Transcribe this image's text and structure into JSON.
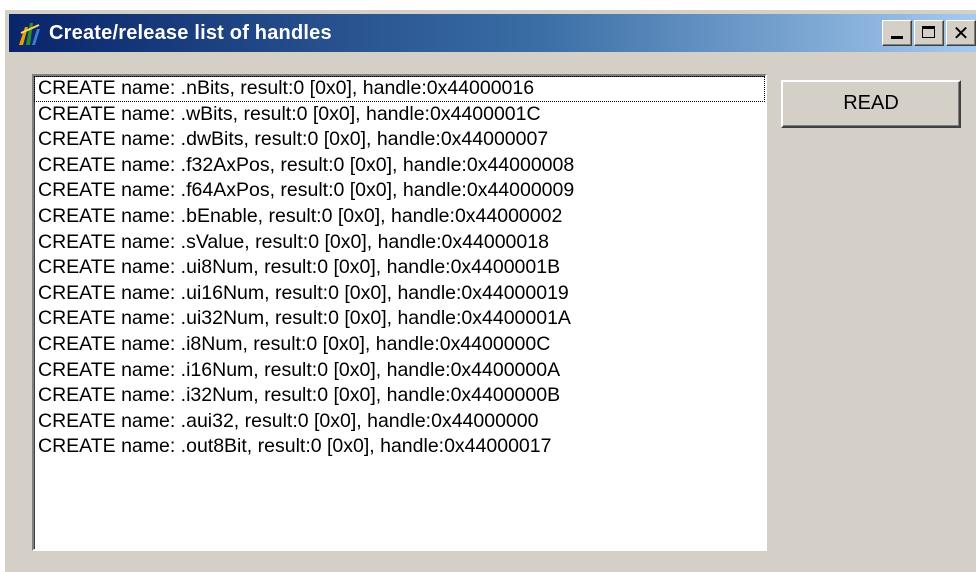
{
  "window": {
    "title": "Create/release list of handles",
    "close_glyph": "✕",
    "icon": "app-icon"
  },
  "list": {
    "items": [
      "CREATE name: .nBits, result:0 [0x0], handle:0x44000016",
      "CREATE name: .wBits, result:0 [0x0], handle:0x4400001C",
      "CREATE name: .dwBits, result:0 [0x0], handle:0x44000007",
      "CREATE name: .f32AxPos, result:0 [0x0], handle:0x44000008",
      "CREATE name: .f64AxPos, result:0 [0x0], handle:0x44000009",
      "CREATE name: .bEnable, result:0 [0x0], handle:0x44000002",
      "CREATE name: .sValue, result:0 [0x0], handle:0x44000018",
      "CREATE name: .ui8Num, result:0 [0x0], handle:0x4400001B",
      "CREATE name: .ui16Num, result:0 [0x0], handle:0x44000019",
      "CREATE name: .ui32Num, result:0 [0x0], handle:0x4400001A",
      "CREATE name: .i8Num, result:0 [0x0], handle:0x4400000C",
      "CREATE name: .i16Num, result:0 [0x0], handle:0x4400000A",
      "CREATE name: .i32Num, result:0 [0x0], handle:0x4400000B",
      "CREATE name: .aui32, result:0 [0x0], handle:0x44000000",
      "CREATE name: .out8Bit, result:0 [0x0], handle:0x44000017"
    ]
  },
  "buttons": {
    "read_label": "READ"
  },
  "colors": {
    "title_bar_start": "#0a246a",
    "title_bar_end": "#a6caf0",
    "window_face": "#d4d0c8"
  }
}
